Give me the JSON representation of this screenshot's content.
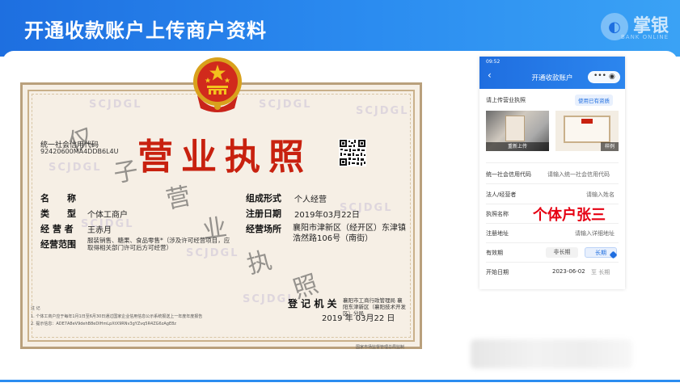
{
  "header": {
    "title": "开通收款账户上传商户资料",
    "brand_name": "掌银",
    "brand_sub": "BANK ONLINE"
  },
  "license": {
    "title": "营业执照",
    "credit_code_label": "统一社会信用代码",
    "credit_code": "92420600MA4DDB6L4U",
    "fields": {
      "name_label": "名　　称",
      "name_value": "",
      "type_label": "类　　型",
      "type_value": "个体工商户",
      "operator_label": "经 营 者",
      "operator_value": "王赤月",
      "scope_label": "经营范围",
      "scope_value": "服装销售、糖果、食品零售*（涉及许可经营项目，应取得相关部门许可后方可经营）",
      "form_label": "组成形式",
      "form_value": "个人经营",
      "reg_date_label": "注册日期",
      "reg_date_value": "2019年03月22日",
      "address_label": "经营场所",
      "address_value": "襄阳市津新区（经开区）东津镇浩然路106号（南街）"
    },
    "registration_authority_label": "登 记 机 关",
    "registration_authority_value": "襄阳市工商行政管理局 襄阳东津新区（襄阳技术开发区）分局",
    "issue_date": "2019 年 03月22 日",
    "handwriting": [
      "仅",
      "子",
      "营",
      "业",
      "执",
      "照"
    ],
    "watermark": "SCJDGL",
    "footnote_title": "注 记",
    "footnote_1": "1. 个体工商户应于每年1月1日至6月30日通过国家企业信用信息公示系统报送上一年度年度报告",
    "footnote_2": "2. 提示信息：ADE7A8eV9dehB8eDIHmLpXtX9RNv3gYZvq5R4ZG6zAgE8z",
    "footer_code": "国家市场监督管理总局监制"
  },
  "phone": {
    "status_time": "09:52",
    "nav_title": "开通收款账户",
    "capsule_dots": "•••",
    "capsule_circle": "◉",
    "upload_label": "请上传营业执照",
    "use_existing_button": "使用已有资质",
    "reupload_caption": "重新上传",
    "sample_caption": "样例",
    "rows": [
      {
        "label": "统一社会信用代码",
        "value": "请输入统一社会信用代码"
      },
      {
        "label": "法人/经营者",
        "value": "请输入姓名"
      },
      {
        "label": "执照名称",
        "value": "个体户张三"
      },
      {
        "label": "注册地址",
        "value": "请输入详细地址"
      },
      {
        "label": "有效期",
        "value": ""
      },
      {
        "label": "开始日期",
        "value": "2023-06-02"
      }
    ],
    "validity_options": [
      "非长期",
      "长期"
    ],
    "end_date_placeholder": "至 长期"
  }
}
